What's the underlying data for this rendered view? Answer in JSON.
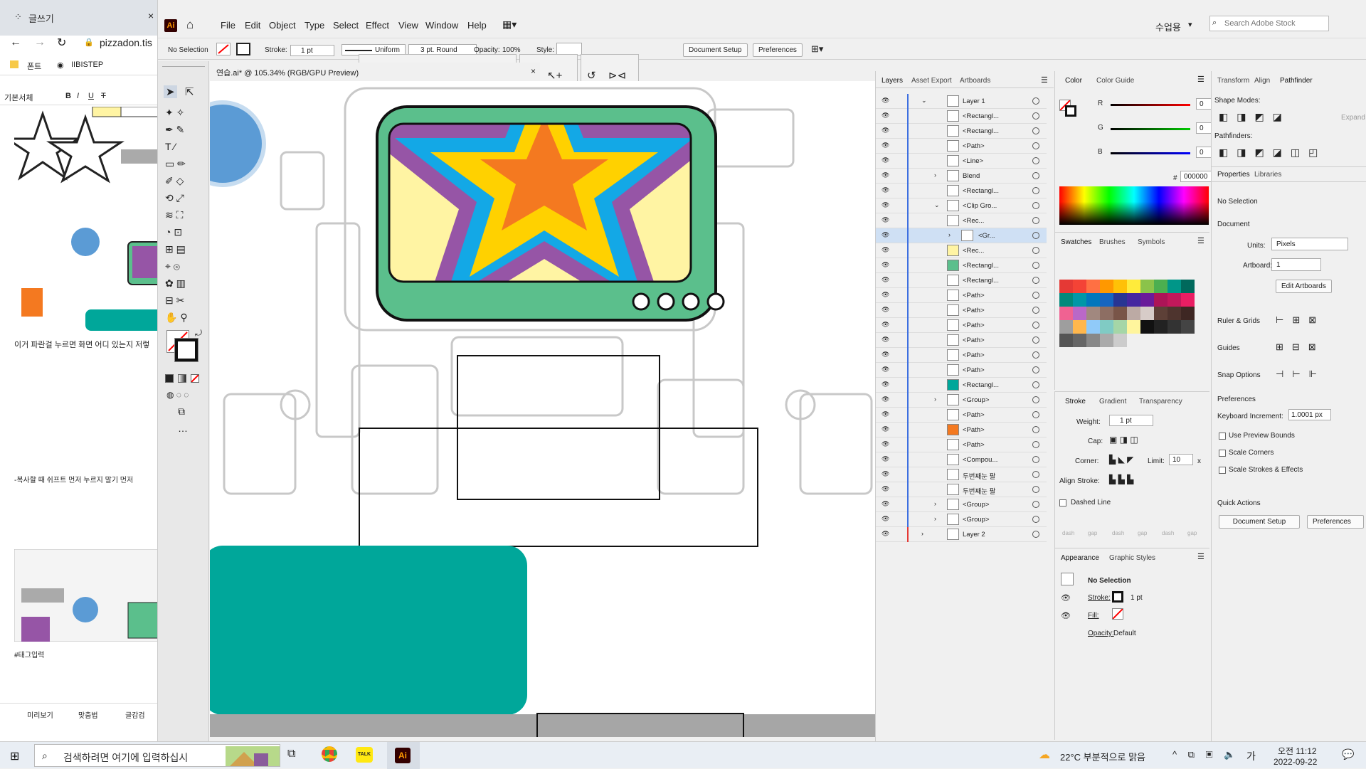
{
  "browser": {
    "tab_title": "글쓰기",
    "address": "pizzadon.tis",
    "bookmarks": [
      {
        "label": "폰트"
      },
      {
        "label": "IIBISTEP"
      }
    ],
    "editor_style": "기본서체",
    "text1": "이거 파란걸 누르면 화면 어디 있는지 저렇",
    "text2": "-복사할 때 쉬프트 먼저 누르지 말기 먼저",
    "tag": "#태그입력",
    "bottom": [
      "미리보기",
      "맞춤법",
      "글감검"
    ]
  },
  "ai": {
    "logo": "Ai",
    "menus": [
      "File",
      "Edit",
      "Object",
      "Type",
      "Select",
      "Effect",
      "View",
      "Window",
      "Help"
    ],
    "workspace": "수업용",
    "search_placeholder": "Search Adobe Stock",
    "control": {
      "selection": "No Selection",
      "stroke_label": "Stroke:",
      "stroke_value": "1 pt",
      "profile": "Uniform",
      "brush": "3 pt. Round",
      "opacity_label": "Opacity:",
      "opacity_value": "100%",
      "style_label": "Style:",
      "document_setup": "Document Setup",
      "preferences": "Preferences"
    },
    "doc_tab": "연습.ai* @ 105.34% (RGB/GPU Preview)",
    "layers_panel": {
      "tabs": [
        "Layers",
        "Asset Export",
        "Artboards"
      ],
      "rows": [
        {
          "name": "Layer 1"
        },
        {
          "name": "<Rectangl..."
        },
        {
          "name": "<Rectangl..."
        },
        {
          "name": "<Path>"
        },
        {
          "name": "<Line>"
        },
        {
          "name": "Blend"
        },
        {
          "name": "<Rectangl..."
        },
        {
          "name": "<Clip Gro..."
        },
        {
          "name": "<Rec..."
        },
        {
          "name": "<Gr..."
        },
        {
          "name": "<Rec..."
        },
        {
          "name": "<Rectangl..."
        },
        {
          "name": "<Rectangl..."
        },
        {
          "name": "<Path>"
        },
        {
          "name": "<Path>"
        },
        {
          "name": "<Path>"
        },
        {
          "name": "<Path>"
        },
        {
          "name": "<Path>"
        },
        {
          "name": "<Path>"
        },
        {
          "name": "<Rectangl..."
        },
        {
          "name": "<Group>"
        },
        {
          "name": "<Path>"
        },
        {
          "name": "<Path>"
        },
        {
          "name": "<Path>"
        },
        {
          "name": "<Compou..."
        },
        {
          "name": "두번째눈 팔"
        },
        {
          "name": "두번째눈 팔"
        },
        {
          "name": "<Group>"
        },
        {
          "name": "<Group>"
        },
        {
          "name": "Layer 2"
        }
      ]
    },
    "color_panel": {
      "tabs": [
        "Color",
        "Color Guide"
      ],
      "r_label": "R",
      "g_label": "G",
      "b_label": "B",
      "r": "0",
      "g": "0",
      "b": "0",
      "hex_label": "#",
      "hex": "000000"
    },
    "swatches_panel": {
      "tabs": [
        "Swatches",
        "Brushes",
        "Symbols"
      ]
    },
    "stroke_panel": {
      "tabs": [
        "Stroke",
        "Gradient",
        "Transparency"
      ],
      "weight_label": "Weight:",
      "weight": "1 pt",
      "cap_label": "Cap:",
      "corner_label": "Corner:",
      "limit_label": "Limit:",
      "limit": "10",
      "limit_x": "x",
      "align_label": "Align Stroke:",
      "dashed": "Dashed Line",
      "dash_labels": [
        "dash",
        "gap",
        "dash",
        "gap",
        "dash",
        "gap"
      ]
    },
    "appearance_panel": {
      "tabs": [
        "Appearance",
        "Graphic Styles"
      ],
      "title": "No Selection",
      "stroke_label": "Stroke:",
      "stroke_value": "1 pt",
      "fill_label": "Fill:",
      "opacity_label": "Opacity:",
      "opacity_value": "Default"
    },
    "right_panel": {
      "tabs": [
        "Transform",
        "Align",
        "Pathfinder"
      ],
      "shape_modes": "Shape Modes:",
      "expand": "Expand",
      "pathfinders": "Pathfinders:",
      "props_tabs": [
        "Properties",
        "Libraries"
      ],
      "no_selection": "No Selection",
      "document": "Document",
      "units_label": "Units:",
      "units": "Pixels",
      "artboard_label": "Artboard:",
      "artboard": "1",
      "edit_artboards": "Edit Artboards",
      "ruler": "Ruler & Grids",
      "guides": "Guides",
      "snap": "Snap Options",
      "preferences": "Preferences",
      "keyboard_label": "Keyboard Increment:",
      "keyboard_value": "1.0001 px",
      "checks": [
        "Use Preview Bounds",
        "Scale Corners",
        "Scale Strokes & Effects"
      ],
      "quick_actions": "Quick Actions",
      "doc_setup": "Document Setup",
      "prefs_btn": "Preferences"
    }
  },
  "taskbar": {
    "search": "검색하려면 여기에 입력하십시",
    "weather": "22°C 부분적으로 맑음",
    "ime": "가",
    "time": "오전 11:12",
    "date": "2022-09-22"
  },
  "colors": {
    "teal": "#00a79a",
    "green": "#5bbf8c",
    "yellow": "#fff4a3",
    "purple": "#9655a6",
    "blue": "#13a8e6",
    "gold": "#ffd100",
    "orange": "#f47920",
    "lightblue": "#5b9bd5"
  }
}
